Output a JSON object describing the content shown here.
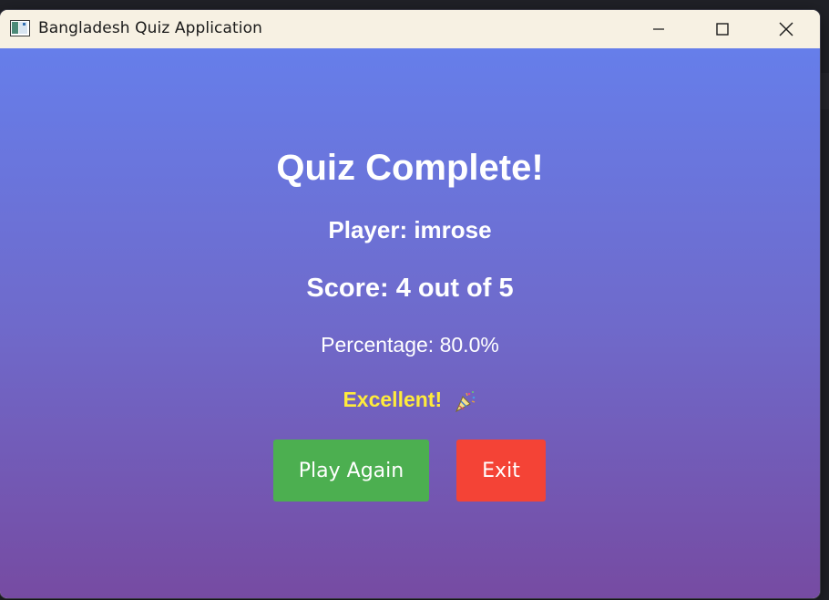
{
  "window": {
    "title": "Bangladesh Quiz Application"
  },
  "colors": {
    "gradient_top": "#667eea",
    "gradient_bottom": "#764ba2",
    "title_bar": "#f7f1e3",
    "play_again": "#4caf50",
    "exit": "#f44336",
    "feedback": "#ffeb3b"
  },
  "results": {
    "heading": "Quiz Complete!",
    "player": "Player: imrose",
    "score": "Score: 4 out of 5",
    "percentage": "Percentage: 80.0%",
    "feedback": "Excellent!",
    "feedback_icon": "party-popper-icon"
  },
  "buttons": {
    "play_again": "Play Again",
    "exit": "Exit"
  }
}
